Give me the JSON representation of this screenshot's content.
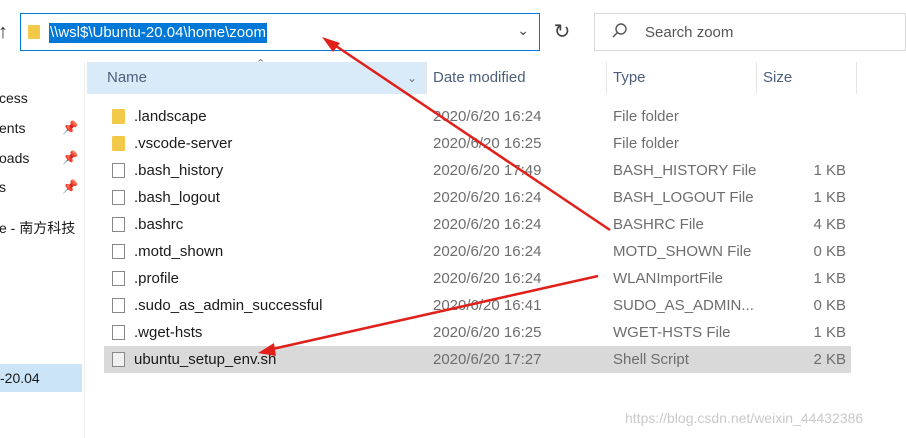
{
  "address": {
    "path": "\\\\wsl$\\Ubuntu-20.04\\home\\zoom",
    "folder_icon": "folder-icon",
    "dropdown_icon": "chevron-down-icon"
  },
  "toolbar": {
    "up_icon": "up-arrow-icon",
    "refresh_icon": "refresh-icon"
  },
  "search": {
    "placeholder": "Search zoom",
    "icon": "search-icon"
  },
  "sidebar": {
    "items": [
      {
        "label": "cess",
        "pinned": false
      },
      {
        "label": "ents",
        "pinned": true
      },
      {
        "label": "oads",
        "pinned": true
      },
      {
        "label": "s",
        "pinned": true
      },
      {
        "label": "e - 南方科技",
        "pinned": false
      },
      {
        "label": "-20.04",
        "pinned": false,
        "selected": true
      }
    ]
  },
  "columns": {
    "name": "Name",
    "date": "Date modified",
    "type": "Type",
    "size": "Size"
  },
  "files": [
    {
      "name": ".landscape",
      "date": "2020/6/20 16:24",
      "type": "File folder",
      "size": "",
      "icon": "folder-icon"
    },
    {
      "name": ".vscode-server",
      "date": "2020/6/20 16:25",
      "type": "File folder",
      "size": "",
      "icon": "folder-icon"
    },
    {
      "name": ".bash_history",
      "date": "2020/6/20 17:49",
      "type": "BASH_HISTORY File",
      "size": "1 KB",
      "icon": "file-icon"
    },
    {
      "name": ".bash_logout",
      "date": "2020/6/20 16:24",
      "type": "BASH_LOGOUT File",
      "size": "1 KB",
      "icon": "file-icon"
    },
    {
      "name": ".bashrc",
      "date": "2020/6/20 16:24",
      "type": "BASHRC File",
      "size": "4 KB",
      "icon": "file-icon"
    },
    {
      "name": ".motd_shown",
      "date": "2020/6/20 16:24",
      "type": "MOTD_SHOWN File",
      "size": "0 KB",
      "icon": "file-icon"
    },
    {
      "name": ".profile",
      "date": "2020/6/20 16:24",
      "type": "WLANImportFile",
      "size": "1 KB",
      "icon": "file-icon"
    },
    {
      "name": ".sudo_as_admin_successful",
      "date": "2020/6/20 16:41",
      "type": "SUDO_AS_ADMIN...",
      "size": "0 KB",
      "icon": "file-icon"
    },
    {
      "name": ".wget-hsts",
      "date": "2020/6/20 16:25",
      "type": "WGET-HSTS File",
      "size": "1 KB",
      "icon": "file-icon"
    },
    {
      "name": "ubuntu_setup_env.sh",
      "date": "2020/6/20 17:27",
      "type": "Shell Script",
      "size": "2 KB",
      "icon": "script-icon",
      "selected": true
    }
  ],
  "watermark": "https://blog.csdn.net/weixin_44432386",
  "colors": {
    "accent": "#0078d7",
    "arrow": "#e0201b",
    "header_highlight": "#d9ebf9",
    "row_selected": "#d9d9d9"
  }
}
